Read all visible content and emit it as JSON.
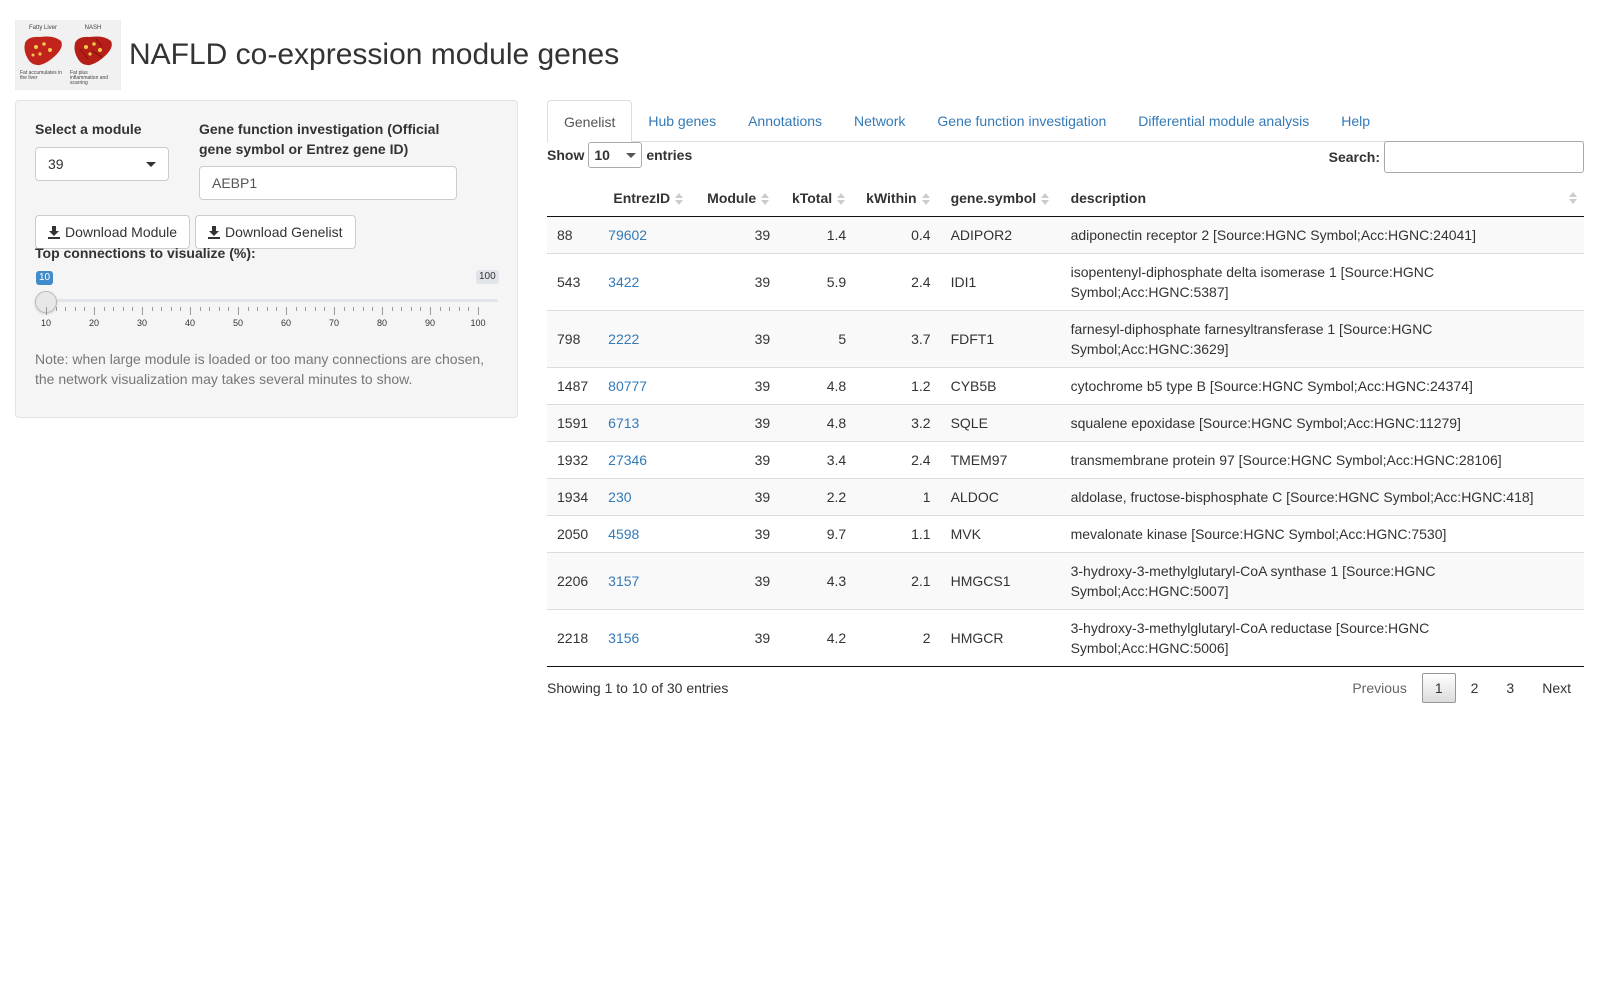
{
  "header": {
    "title": "NAFLD co-expression module genes",
    "logo": {
      "left_caption": "Fatty Liver",
      "left_sub": "Fat accumulates in the liver",
      "right_caption": "NASH",
      "right_sub": "Fat plus inflammation and scarring"
    }
  },
  "sidebar": {
    "module_label": "Select a module",
    "module_value": "39",
    "gene_label": "Gene function investigation (Official gene symbol or Entrez gene ID)",
    "gene_value": "AEBP1",
    "download_module": "Download Module",
    "download_genelist": "Download Genelist",
    "slider_label": "Top connections to visualize (%):",
    "slider_value": 10,
    "slider_value_text": "10",
    "slider_max_text": "100",
    "slider_ticks": [
      "10",
      "20",
      "30",
      "40",
      "50",
      "60",
      "70",
      "80",
      "90",
      "100"
    ],
    "note": "Note: when large module is loaded or too many connections are chosen, the network visualization may takes several minutes to show."
  },
  "tabs": [
    {
      "label": "Genelist",
      "active": true
    },
    {
      "label": "Hub genes"
    },
    {
      "label": "Annotations"
    },
    {
      "label": "Network"
    },
    {
      "label": "Gene function investigation"
    },
    {
      "label": "Differential module analysis"
    },
    {
      "label": "Help"
    }
  ],
  "table_controls": {
    "show_label": "Show",
    "show_value": "10",
    "entries_label": "entries",
    "search_label": "Search:"
  },
  "table": {
    "columns": [
      "",
      "EntrezID",
      "Module",
      "kTotal",
      "kWithin",
      "gene.symbol",
      "description"
    ],
    "rows": [
      [
        "88",
        "79602",
        "39",
        "1.4",
        "0.4",
        "ADIPOR2",
        "adiponectin receptor 2 [Source:HGNC Symbol;Acc:HGNC:24041]"
      ],
      [
        "543",
        "3422",
        "39",
        "5.9",
        "2.4",
        "IDI1",
        "isopentenyl-diphosphate delta isomerase 1 [Source:HGNC Symbol;Acc:HGNC:5387]"
      ],
      [
        "798",
        "2222",
        "39",
        "5",
        "3.7",
        "FDFT1",
        "farnesyl-diphosphate farnesyltransferase 1 [Source:HGNC Symbol;Acc:HGNC:3629]"
      ],
      [
        "1487",
        "80777",
        "39",
        "4.8",
        "1.2",
        "CYB5B",
        "cytochrome b5 type B [Source:HGNC Symbol;Acc:HGNC:24374]"
      ],
      [
        "1591",
        "6713",
        "39",
        "4.8",
        "3.2",
        "SQLE",
        "squalene epoxidase [Source:HGNC Symbol;Acc:HGNC:11279]"
      ],
      [
        "1932",
        "27346",
        "39",
        "3.4",
        "2.4",
        "TMEM97",
        "transmembrane protein 97 [Source:HGNC Symbol;Acc:HGNC:28106]"
      ],
      [
        "1934",
        "230",
        "39",
        "2.2",
        "1",
        "ALDOC",
        "aldolase, fructose-bisphosphate C [Source:HGNC Symbol;Acc:HGNC:418]"
      ],
      [
        "2050",
        "4598",
        "39",
        "9.7",
        "1.1",
        "MVK",
        "mevalonate kinase [Source:HGNC Symbol;Acc:HGNC:7530]"
      ],
      [
        "2206",
        "3157",
        "39",
        "4.3",
        "2.1",
        "HMGCS1",
        "3-hydroxy-3-methylglutaryl-CoA synthase 1 [Source:HGNC Symbol;Acc:HGNC:5007]"
      ],
      [
        "2218",
        "3156",
        "39",
        "4.2",
        "2",
        "HMGCR",
        "3-hydroxy-3-methylglutaryl-CoA reductase [Source:HGNC Symbol;Acc:HGNC:5006]"
      ]
    ]
  },
  "footer": {
    "info": "Showing 1 to 10 of 30 entries",
    "previous": "Previous",
    "pages": [
      "1",
      "2",
      "3"
    ],
    "current_page": "1",
    "next": "Next"
  },
  "colors": {
    "link": "#337ab7",
    "slider_accent": "#428bca"
  }
}
